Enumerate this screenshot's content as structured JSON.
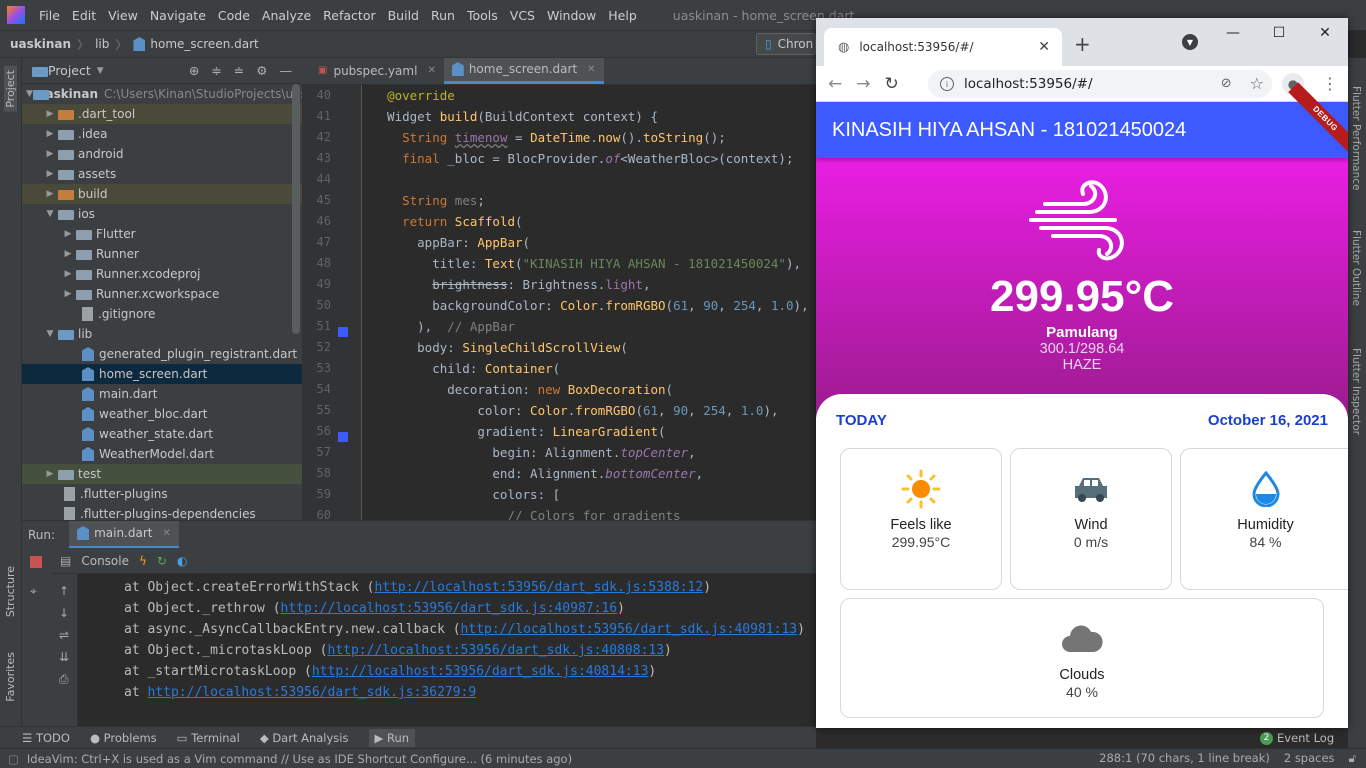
{
  "menu": {
    "items": [
      "File",
      "Edit",
      "View",
      "Navigate",
      "Code",
      "Analyze",
      "Refactor",
      "Build",
      "Run",
      "Tools",
      "VCS",
      "Window",
      "Help"
    ],
    "window_title": "uaskinan - home_screen.dart"
  },
  "breadcrumb": {
    "project": "uaskinan",
    "folder": "lib",
    "file": "home_screen.dart"
  },
  "run_config": "Chron",
  "project_panel": {
    "title": "Project",
    "root": {
      "name": "uaskinan",
      "path": "C:\\Users\\Kinan\\StudioProjects\\uas"
    },
    "items": [
      ".dart_tool",
      ".idea",
      "android",
      "assets",
      "build",
      "ios",
      "Flutter",
      "Runner",
      "Runner.xcodeproj",
      "Runner.xcworkspace",
      ".gitignore",
      "lib",
      "generated_plugin_registrant.dart",
      "home_screen.dart",
      "main.dart",
      "weather_bloc.dart",
      "weather_state.dart",
      "WeatherModel.dart",
      "test",
      ".flutter-plugins",
      ".flutter-plugins-dependencies"
    ]
  },
  "editor": {
    "tabs": [
      "pubspec.yaml",
      "home_screen.dart"
    ],
    "line_numbers": [
      "40",
      "41",
      "42",
      "43",
      "44",
      "45",
      "46",
      "47",
      "48",
      "49",
      "50",
      "51",
      "52",
      "53",
      "54",
      "55",
      "56",
      "57",
      "58",
      "59",
      "60"
    ]
  },
  "run_panel": {
    "label": "Run:",
    "tab": "main.dart",
    "console_label": "Console",
    "lines": [
      {
        "prefix": "at Object.createErrorWithStack (",
        "link": "http://localhost:53956/dart_sdk.js:5388:12",
        "suffix": ")"
      },
      {
        "prefix": "at Object._rethrow (",
        "link": "http://localhost:53956/dart_sdk.js:40987:16",
        "suffix": ")"
      },
      {
        "prefix": "at async._AsyncCallbackEntry.new.callback (",
        "link": "http://localhost:53956/dart_sdk.js:40981:13",
        "suffix": ")"
      },
      {
        "prefix": "at Object._microtaskLoop (",
        "link": "http://localhost:53956/dart_sdk.js:40808:13",
        "suffix": ")"
      },
      {
        "prefix": "at _startMicrotaskLoop (",
        "link": "http://localhost:53956/dart_sdk.js:40814:13",
        "suffix": ")"
      },
      {
        "prefix": "at ",
        "link": "http://localhost:53956/dart_sdk.js:36279:9",
        "suffix": ""
      }
    ]
  },
  "bottom_tabs": [
    "TODO",
    "Problems",
    "Terminal",
    "Dart Analysis",
    "Run"
  ],
  "status": {
    "message": "IdeaVim: Ctrl+X is used as a Vim command // Use as IDE Shortcut   Configure... (6 minutes ago)",
    "position": "288:1 (70 chars, 1 line break)",
    "indent": "2 spaces",
    "event_log": "Event Log",
    "event_count": "2"
  },
  "side_tabs": {
    "left": [
      "Project",
      "Structure",
      "Favorites"
    ],
    "right": [
      "Flutter Performance",
      "Flutter Outline",
      "Flutter Inspector"
    ]
  },
  "browser": {
    "tab_title": "localhost:53956/#/",
    "url": "localhost:53956/#/",
    "app": {
      "title": "KINASIH HIYA AHSAN - 181021450024",
      "debug_banner": "DEBUG",
      "temperature": "299.95°C",
      "city": "Pamulang",
      "minmax": "300.1/298.64",
      "condition": "HAZE",
      "today_label": "TODAY",
      "date": "October 16, 2021",
      "cards": [
        {
          "label": "Feels like",
          "value": "299.95°C",
          "icon": "sun-icon"
        },
        {
          "label": "Wind",
          "value": "0 m/s",
          "icon": "car-icon"
        },
        {
          "label": "Humidity",
          "value": "84 %",
          "icon": "water-drop-icon"
        },
        {
          "label": "Clouds",
          "value": "40 %",
          "icon": "cloud-icon"
        }
      ]
    }
  }
}
